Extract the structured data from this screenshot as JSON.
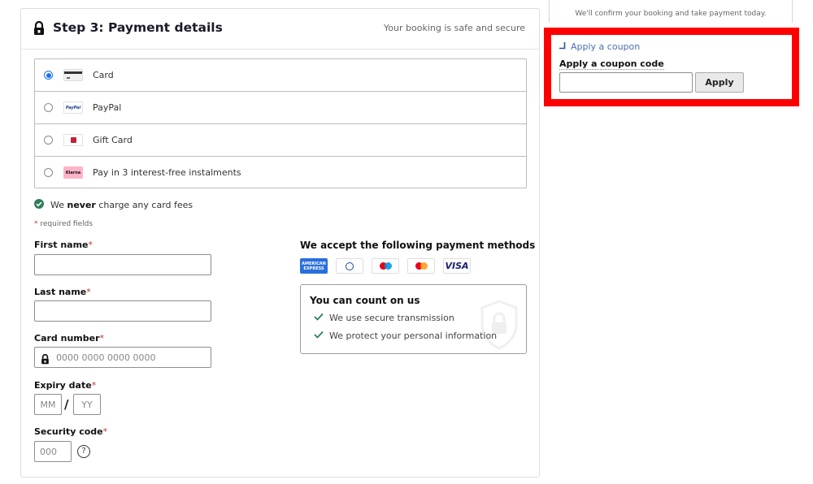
{
  "header": {
    "title": "Step 3: Payment details",
    "secure_note": "Your booking is safe and secure"
  },
  "payment_methods": [
    {
      "label": "Card",
      "icon": "credit-card-icon",
      "selected": true
    },
    {
      "label": "PayPal",
      "icon": "paypal-logo",
      "icon_text": "PayPal",
      "selected": false
    },
    {
      "label": "Gift Card",
      "icon": "gift-card-icon",
      "selected": false
    },
    {
      "label": "Pay in 3 interest-free instalments",
      "icon": "klarna-logo",
      "icon_text": "Klarna",
      "selected": false
    }
  ],
  "fees_note": {
    "prefix": "We ",
    "bold": "never",
    "suffix": " charge any card fees"
  },
  "required_note": {
    "star": "*",
    "text": " required fields"
  },
  "form": {
    "first_name": {
      "label": "First name",
      "value": "",
      "placeholder": ""
    },
    "last_name": {
      "label": "Last name",
      "value": "",
      "placeholder": ""
    },
    "card_number": {
      "label": "Card number",
      "value": "",
      "placeholder": "0000 0000 0000 0000"
    },
    "expiry": {
      "label": "Expiry date",
      "month_placeholder": "MM",
      "year_placeholder": "YY",
      "separator": "/"
    },
    "security_code": {
      "label": "Security code",
      "placeholder": "000",
      "help": "?"
    },
    "required_star": "*"
  },
  "accepted": {
    "title": "We accept the following payment methods",
    "logos": [
      {
        "name": "American Express",
        "text_line1": "AMERICAN",
        "text_line2": "EXPRESS"
      },
      {
        "name": "Diners Club"
      },
      {
        "name": "Maestro"
      },
      {
        "name": "Mastercard"
      },
      {
        "name": "Visa",
        "text": "VISA"
      }
    ]
  },
  "trust": {
    "title": "You can count on us",
    "items": [
      "We use secure transmission",
      "We protect your personal information"
    ]
  },
  "sidebar": {
    "confirm_note": "We'll confirm your booking and take payment today.",
    "coupon_toggle": "Apply a coupon",
    "coupon_label": "Apply a coupon code",
    "coupon_value": "",
    "apply_button": "Apply"
  },
  "colors": {
    "radio_selected": "#1a73e8",
    "check_green": "#2e7d5b",
    "required_star": "#c0392b",
    "link": "#4a6fb0",
    "highlight": "#ff0000"
  }
}
